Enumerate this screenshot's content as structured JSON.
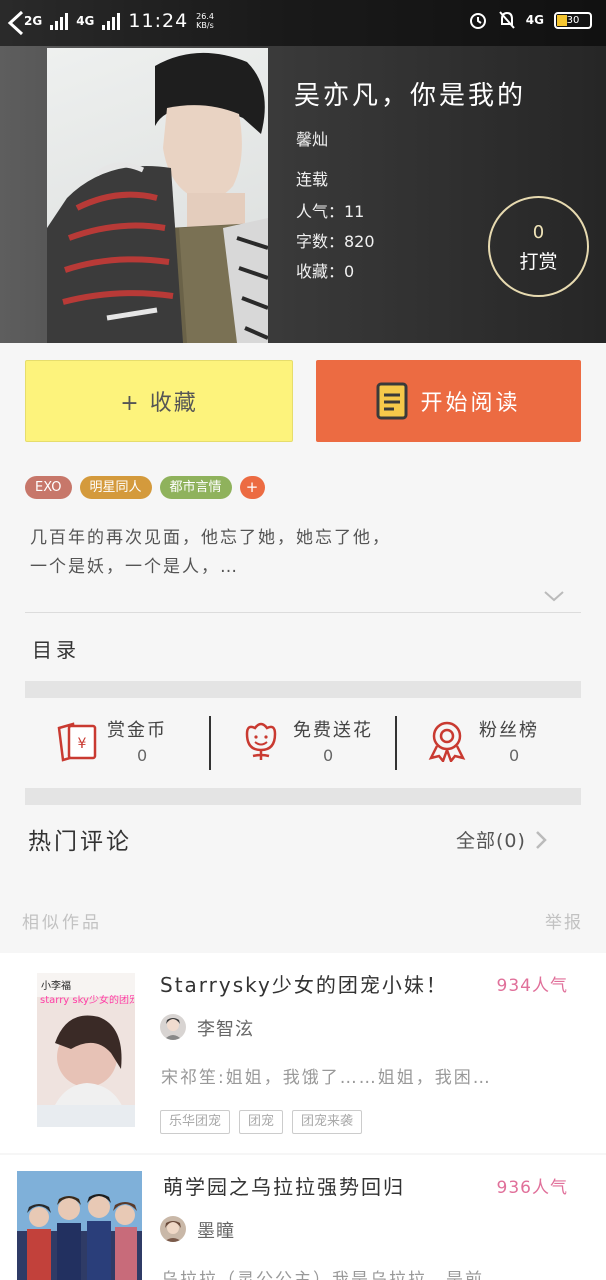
{
  "status_bar": {
    "network_1": "2G",
    "network_2": "4G",
    "time": "11:24",
    "speed_value": "26.4",
    "speed_unit": "KB/s",
    "network_3": "4G",
    "battery": "30"
  },
  "book": {
    "title": "吴亦凡，你是我的",
    "author": "馨灿",
    "status": "连载",
    "popularity": "人气：11",
    "word_count": "字数：820",
    "favorites": "收藏：0",
    "reward_count": "0",
    "reward_label": "打赏"
  },
  "actions": {
    "collect_label": "+ 收藏",
    "read_label": "开始阅读"
  },
  "tags": [
    {
      "label": "EXO",
      "color": "#c7776a"
    },
    {
      "label": "明星同人",
      "color": "#d49a3c"
    },
    {
      "label": "都市言情",
      "color": "#8fb25c"
    }
  ],
  "tag_add": "+",
  "intro": {
    "line1": "几百年的再次见面，他忘了她，她忘了他，",
    "line2": "一个是妖，一个是人，…"
  },
  "catalog_label": "目录",
  "stats": [
    {
      "label": "赏金币",
      "value": "0",
      "icon": "red-envelope-icon"
    },
    {
      "label": "免费送花",
      "value": "0",
      "icon": "flower-icon"
    },
    {
      "label": "粉丝榜",
      "value": "0",
      "icon": "award-ribbon-icon"
    }
  ],
  "comments": {
    "title": "热门评论",
    "all_label": "全部(0)"
  },
  "similar": {
    "title": "相似作品",
    "report": "举报"
  },
  "works": [
    {
      "title": "Starrysky少女的团宠小妹！",
      "popularity": "934人气",
      "author": "李智泫",
      "desc": "宋祁笙:姐姐，我饿了……姐姐，我困…",
      "tags": [
        "乐华团宠",
        "团宠",
        "团宠来袭"
      ],
      "cover_text_top": "小李福",
      "cover_text_main": "starry sky少女的团宠小妹"
    },
    {
      "title": "萌学园之乌拉拉强势回归",
      "popularity": "936人气",
      "author": "墨瞳",
      "desc": "乌拉拉（灵公公主）我是乌拉拉，是前…",
      "tags": []
    }
  ],
  "colors": {
    "accent": "#ec6b42",
    "collect_bg": "#fdf37c",
    "popularity": "#e0709a"
  }
}
